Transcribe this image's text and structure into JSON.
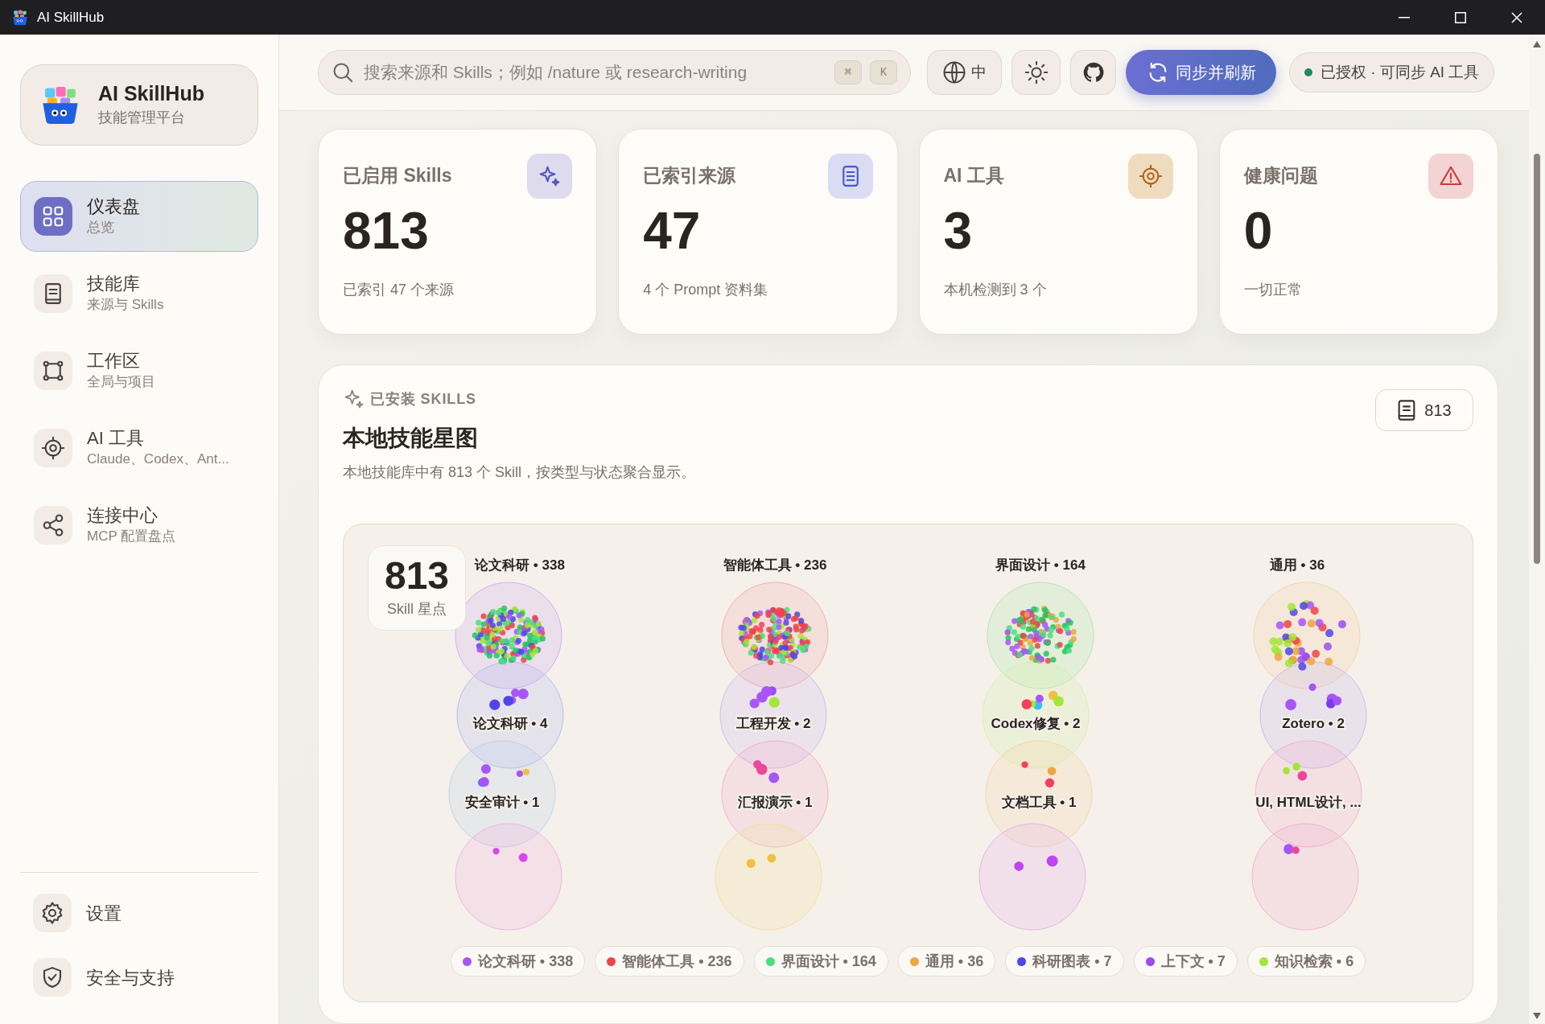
{
  "window": {
    "title": "AI SkillHub"
  },
  "brand": {
    "name": "AI SkillHub",
    "subtitle": "技能管理平台"
  },
  "nav": [
    {
      "label": "仪表盘",
      "sub": "总览",
      "selected": true
    },
    {
      "label": "技能库",
      "sub": "来源与 Skills",
      "selected": false
    },
    {
      "label": "工作区",
      "sub": "全局与项目",
      "selected": false
    },
    {
      "label": "AI 工具",
      "sub": "Claude、Codex、Ant...",
      "selected": false
    },
    {
      "label": "连接中心",
      "sub": "MCP 配置盘点",
      "selected": false
    }
  ],
  "nav_bottom": [
    {
      "label": "设置"
    },
    {
      "label": "安全与支持"
    }
  ],
  "search": {
    "placeholder": "搜索来源和 Skills；例如 /nature 或 research-writing",
    "keys": [
      "⌘",
      "K"
    ]
  },
  "toolbar": {
    "language": "中",
    "sync_button": "同步并刷新",
    "status": "已授权 · 可同步 AI 工具"
  },
  "stats": [
    {
      "title": "已启用 Skills",
      "value": "813",
      "note": "已索引 47 个来源"
    },
    {
      "title": "已索引来源",
      "value": "47",
      "note": "4 个 Prompt 资料集"
    },
    {
      "title": "AI 工具",
      "value": "3",
      "note": "本机检测到 3 个"
    },
    {
      "title": "健康问题",
      "value": "0",
      "note": "一切正常"
    }
  ],
  "skills_panel": {
    "eyebrow": "已安装 SKILLS",
    "title": "本地技能星图",
    "description": "本地技能库中有 813 个 Skill，按类型与状态聚合显示。",
    "count": "813",
    "total": "813",
    "total_label": "Skill 星点",
    "columns": [
      {
        "title": "论文科研 • 338",
        "bubble_labels": [
          "论文科研 • 4",
          "安全审计 • 1"
        ]
      },
      {
        "title": "智能体工具 • 236",
        "bubble_labels": [
          "工程开发 • 2",
          "汇报演示 • 1"
        ]
      },
      {
        "title": "界面设计 • 164",
        "bubble_labels": [
          "Codex修复 • 2",
          "文档工具 • 1"
        ]
      },
      {
        "title": "通用 • 36",
        "bubble_labels": [
          "Zotero • 2",
          "UI, HTML设计, ..."
        ]
      }
    ],
    "legend": [
      {
        "label": "论文科研 • 338",
        "color": "#a855f7"
      },
      {
        "label": "智能体工具 • 236",
        "color": "#ef4444"
      },
      {
        "label": "界面设计 • 164",
        "color": "#4ade80"
      },
      {
        "label": "通用 • 36",
        "color": "#f0a540"
      },
      {
        "label": "科研图表 • 7",
        "color": "#4f46e5"
      },
      {
        "label": "上下文 • 7",
        "color": "#9b4cf0"
      },
      {
        "label": "知识检索 • 6",
        "color": "#a3e635"
      }
    ]
  }
}
